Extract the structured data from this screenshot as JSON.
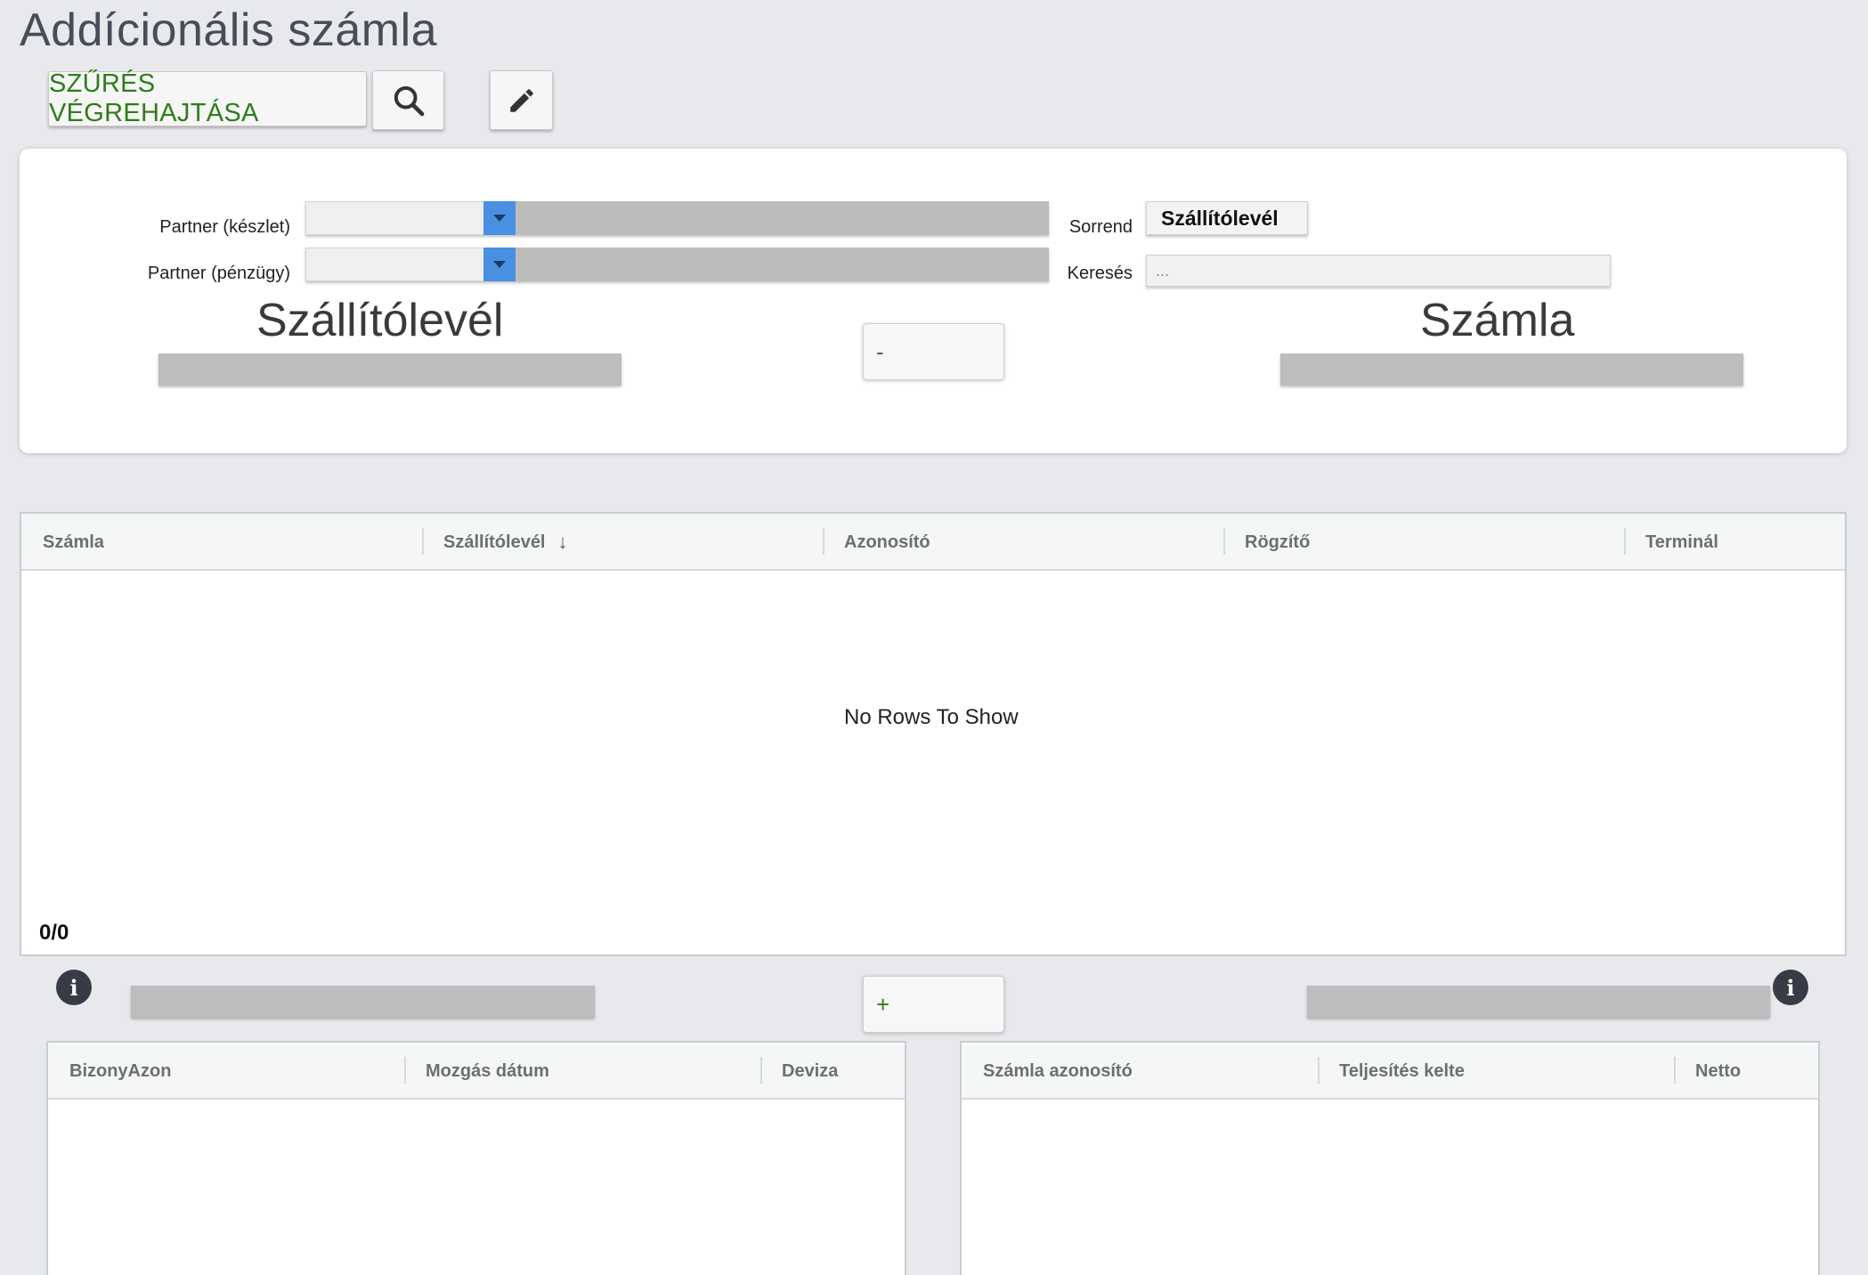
{
  "page": {
    "title": "Addícionális számla"
  },
  "toolbar": {
    "filter_label": "SZŰRÉS VÉGREHAJTÁSA",
    "search_icon": "search-icon",
    "edit_icon": "pencil-icon"
  },
  "filters": {
    "partner_stock_label": "Partner (készlet)",
    "partner_finance_label": "Partner (pénzügy)",
    "order_label": "Sorrend",
    "order_value": "Szállítólevél",
    "search_label": "Keresés",
    "search_placeholder": "...",
    "left_heading": "Szállítólevél",
    "right_heading": "Számla",
    "minus_label": "-"
  },
  "main_grid": {
    "columns": [
      "Számla",
      "Szállítólevél",
      "Azonosító",
      "Rögzítő",
      "Terminál"
    ],
    "sort_indicator": "↓",
    "empty_text": "No Rows To Show",
    "row_count": "0/0"
  },
  "lower": {
    "plus_label": "+",
    "info_icon": "i"
  },
  "left_grid": {
    "columns": [
      "BizonyAzon",
      "Mozgás dátum",
      "Deviza"
    ]
  },
  "right_grid": {
    "columns": [
      "Számla azonosító",
      "Teljesítés kelte",
      "Netto"
    ]
  },
  "colors": {
    "accent_green": "#2e7d1a",
    "dropdown_blue": "#4a90e2",
    "background": "#e8e9ed"
  }
}
